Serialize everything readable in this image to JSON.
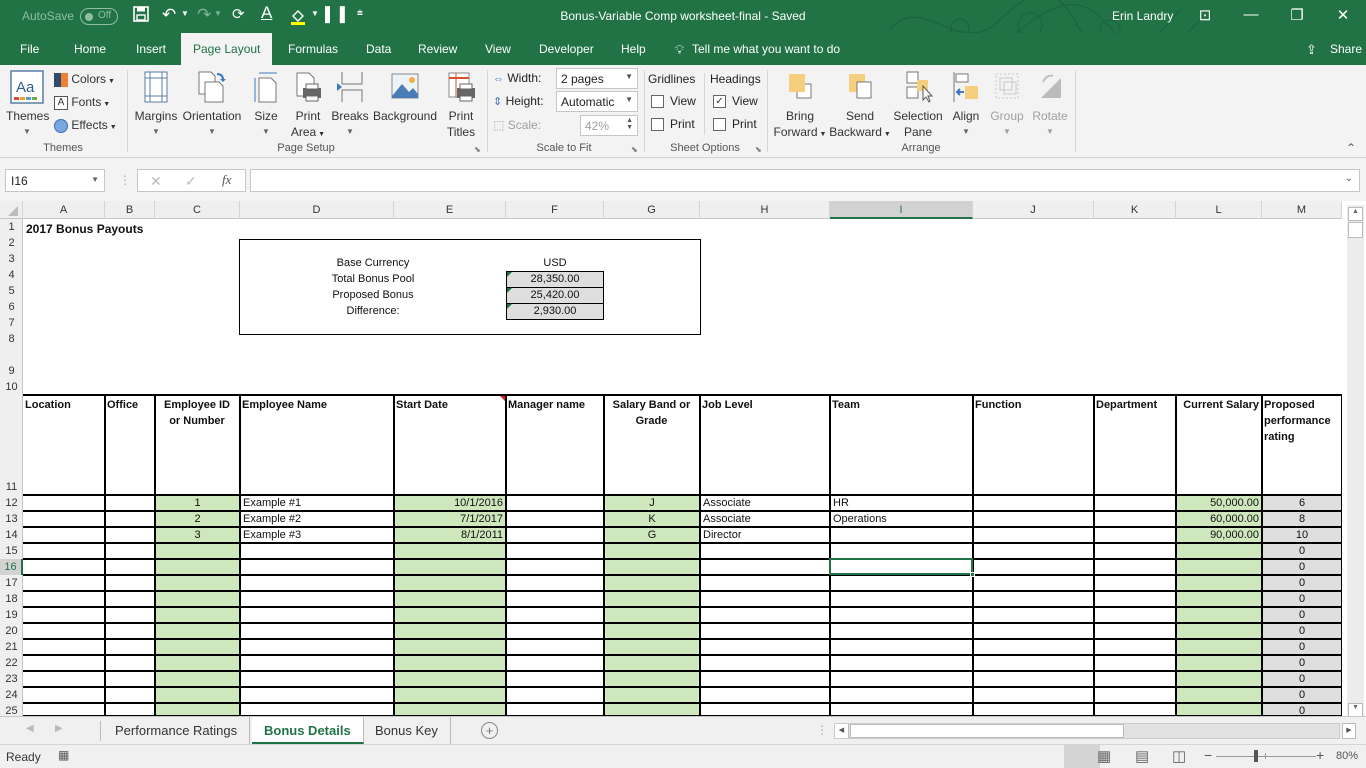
{
  "titlebar": {
    "autosave_label": "AutoSave",
    "autosave_state": "Off",
    "doc_title": "Bonus-Variable Comp worksheet-final  -  Saved",
    "user_name": "Erin Landry",
    "qat_icons": [
      "save-icon",
      "undo-icon",
      "redo-icon",
      "refresh-icon",
      "font-color-icon",
      "fill-color-icon",
      "merge-icon",
      "customize-qat-icon"
    ],
    "window_icons": {
      "ribbon_display": "⊡",
      "minimize": "—",
      "restore": "❐",
      "close": "✕"
    }
  },
  "tabs": [
    {
      "label": "File"
    },
    {
      "label": "Home"
    },
    {
      "label": "Insert"
    },
    {
      "label": "Page Layout",
      "active": true
    },
    {
      "label": "Formulas"
    },
    {
      "label": "Data"
    },
    {
      "label": "Review"
    },
    {
      "label": "View"
    },
    {
      "label": "Developer"
    },
    {
      "label": "Help"
    }
  ],
  "tell_me": "Tell me what you want to do",
  "share_label": "Share",
  "ribbon": {
    "themes_group": {
      "label": "Themes",
      "themes": "Themes",
      "colors": "Colors",
      "fonts": "Fonts",
      "effects": "Effects"
    },
    "page_setup_group": {
      "label": "Page Setup",
      "margins": "Margins",
      "orientation": "Orientation",
      "size": "Size",
      "print_area_1": "Print",
      "print_area_2": "Area",
      "breaks": "Breaks",
      "background": "Background",
      "print_titles_1": "Print",
      "print_titles_2": "Titles"
    },
    "scale_group": {
      "label": "Scale to Fit",
      "width_label": "Width:",
      "width_value": "2 pages",
      "height_label": "Height:",
      "height_value": "Automatic",
      "scale_label": "Scale:",
      "scale_value": "42%"
    },
    "sheet_options_group": {
      "label": "Sheet Options",
      "gridlines": "Gridlines",
      "headings": "Headings",
      "view": "View",
      "print": "Print",
      "gridlines_view": false,
      "gridlines_print": false,
      "headings_view": true,
      "headings_print": false
    },
    "arrange_group": {
      "label": "Arrange",
      "bring_1": "Bring",
      "bring_2": "Forward",
      "send_1": "Send",
      "send_2": "Backward",
      "selection_1": "Selection",
      "selection_2": "Pane",
      "align": "Align",
      "group": "Group",
      "rotate": "Rotate"
    }
  },
  "formula_bar": {
    "name_box": "I16",
    "formula": "",
    "cancel": "✕",
    "enter": "✓",
    "fx": "fx"
  },
  "columns": [
    "A",
    "B",
    "C",
    "D",
    "E",
    "F",
    "G",
    "H",
    "I",
    "J",
    "K",
    "L",
    "M"
  ],
  "selected_column": "I",
  "rows": [
    "1",
    "2",
    "3",
    "4",
    "5",
    "6",
    "7",
    "8",
    "9",
    "10",
    "11",
    "12",
    "13",
    "14",
    "15",
    "16",
    "17",
    "18",
    "19",
    "20",
    "21",
    "22",
    "23",
    "24",
    "25"
  ],
  "selected_row": "16",
  "sheet": {
    "title": "2017 Bonus Payouts",
    "summary": {
      "base_currency_label": "Base Currency",
      "base_currency_value": "USD",
      "total_pool_label": "Total Bonus Pool",
      "total_pool_value": "28,350.00",
      "proposed_label": "Proposed Bonus",
      "proposed_value": "25,420.00",
      "difference_label": "Difference:",
      "difference_value": "2,930.00"
    },
    "headers": [
      "Location",
      "Office",
      "Employee ID or Number",
      "Employee Name",
      "Start Date",
      "Manager name",
      "Salary Band or Grade",
      "Job Level",
      "Team",
      "Function",
      "Department",
      "Current Salary",
      "Proposed performance rating"
    ],
    "data_rows": [
      {
        "id": "1",
        "name": "Example #1",
        "start": "10/1/2016",
        "grade": "J",
        "level": "Associate",
        "team": "HR",
        "salary": "50,000.00",
        "rating": "6"
      },
      {
        "id": "2",
        "name": "Example #2",
        "start": "7/1/2017",
        "grade": "K",
        "level": "Associate",
        "team": "Operations",
        "salary": "60,000.00",
        "rating": "8"
      },
      {
        "id": "3",
        "name": "Example #3",
        "start": "8/1/2011",
        "grade": "G",
        "level": "Director",
        "team": "",
        "salary": "90,000.00",
        "rating": "10"
      }
    ],
    "empty_rating": "0"
  },
  "sheet_tabs": [
    {
      "label": "Performance Ratings"
    },
    {
      "label": "Bonus Details",
      "active": true
    },
    {
      "label": "Bonus Key"
    }
  ],
  "status": {
    "ready": "Ready",
    "zoom": "80%",
    "zoom_fraction": 0.4
  }
}
